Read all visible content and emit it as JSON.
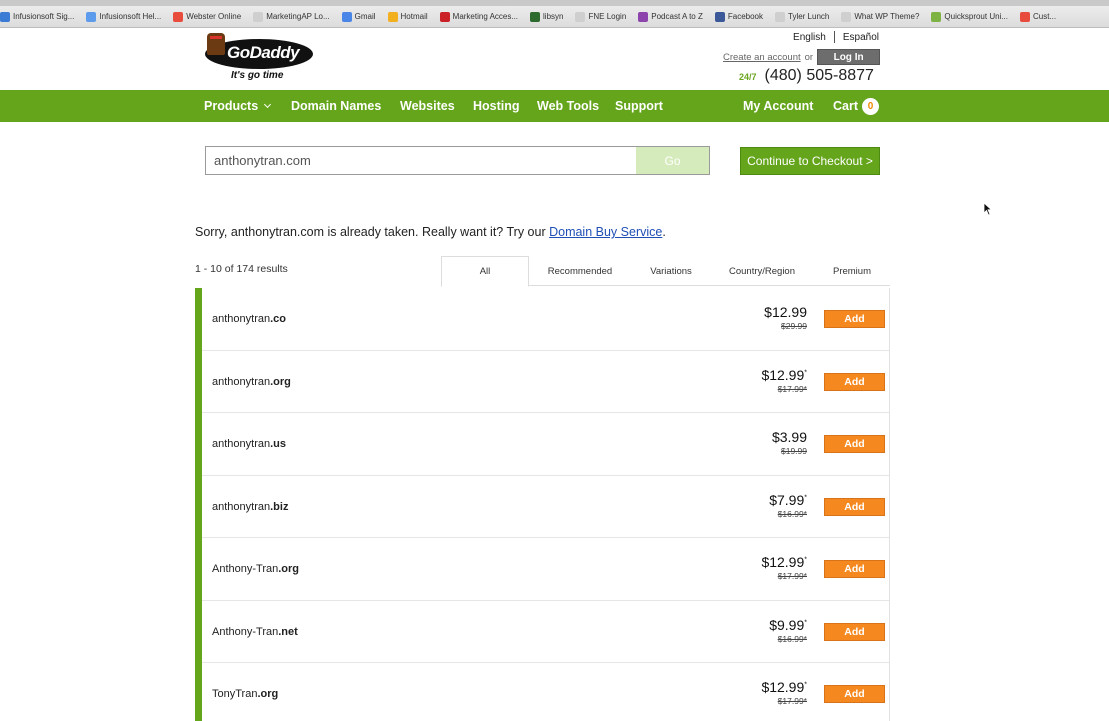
{
  "bookmarks": [
    {
      "label": "Infusionsoft Sig...",
      "color": "#3a7bd5"
    },
    {
      "label": "Infusionsoft Hel...",
      "color": "#5d9cec"
    },
    {
      "label": "Webster Online",
      "color": "#e74c3c"
    },
    {
      "label": "MarketingAP Lo...",
      "color": "#cfcfcf"
    },
    {
      "label": "Gmail",
      "color": "#4a86e8"
    },
    {
      "label": "Hotmail",
      "color": "#f2b01e"
    },
    {
      "label": "Marketing Acces...",
      "color": "#cc2027"
    },
    {
      "label": "libsyn",
      "color": "#2d6a2d"
    },
    {
      "label": "FNE Login",
      "color": "#cfcfcf"
    },
    {
      "label": "Podcast A to Z",
      "color": "#8e44ad"
    },
    {
      "label": "Facebook",
      "color": "#3b5998"
    },
    {
      "label": "Tyler Lunch",
      "color": "#cfcfcf"
    },
    {
      "label": "What WP Theme?",
      "color": "#cfcfcf"
    },
    {
      "label": "Quicksprout Uni...",
      "color": "#7cb342"
    },
    {
      "label": "Cust...",
      "color": "#e74c3c"
    }
  ],
  "header": {
    "logo_text": "GoDaddy",
    "logo_tagline": "It's go time",
    "lang_english": "English",
    "lang_espanol": "Español",
    "create_account": "Create an account",
    "or": "or",
    "login": "Log In",
    "support_hours": "24/7",
    "phone": "(480) 505-8877"
  },
  "nav": {
    "products": "Products",
    "domain_names": "Domain Names",
    "websites": "Websites",
    "hosting": "Hosting",
    "web_tools": "Web Tools",
    "support": "Support",
    "my_account": "My Account",
    "cart": "Cart",
    "cart_count": "0"
  },
  "search": {
    "value": "anthonytran.com",
    "go": "Go",
    "checkout": "Continue to Checkout >"
  },
  "message": {
    "before": "Sorry, anthonytran.com is already taken. Really want it? Try our ",
    "link": "Domain Buy Service",
    "after": "."
  },
  "results": {
    "count": "1 - 10 of 174 results",
    "tabs": [
      "All",
      "Recommended",
      "Variations",
      "Country/Region",
      "Premium"
    ],
    "active_tab": "All",
    "add_label": "Add",
    "rows": [
      {
        "name": "anthonytran",
        "tld": ".co",
        "price": "$12.99",
        "mark": "",
        "old": "$29.99"
      },
      {
        "name": "anthonytran",
        "tld": ".org",
        "price": "$12.99",
        "mark": "*",
        "old": "$17.99*"
      },
      {
        "name": "anthonytran",
        "tld": ".us",
        "price": "$3.99",
        "mark": "",
        "old": "$19.99"
      },
      {
        "name": "anthonytran",
        "tld": ".biz",
        "price": "$7.99",
        "mark": "*",
        "old": "$16.99*"
      },
      {
        "name": "Anthony-Tran",
        "tld": ".org",
        "price": "$12.99",
        "mark": "*",
        "old": "$17.99*"
      },
      {
        "name": "Anthony-Tran",
        "tld": ".net",
        "price": "$9.99",
        "mark": "*",
        "old": "$16.99*"
      },
      {
        "name": "TonyTran",
        "tld": ".org",
        "price": "$12.99",
        "mark": "*",
        "old": "$17.99*"
      }
    ]
  }
}
